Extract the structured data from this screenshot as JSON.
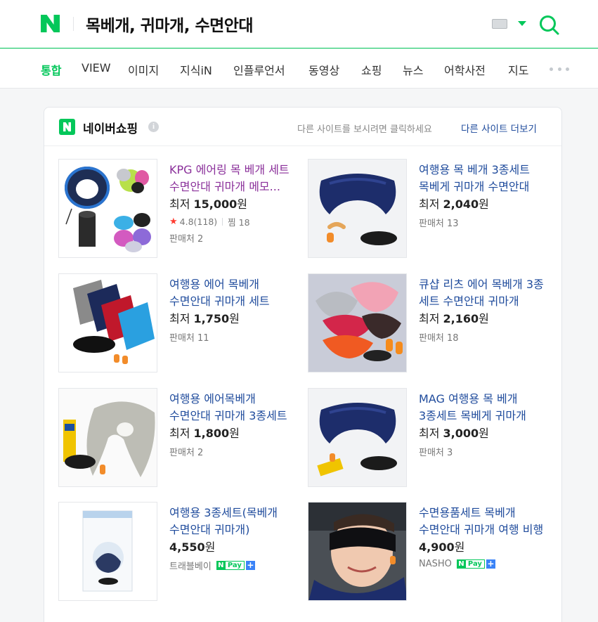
{
  "search": {
    "query": "목베개, 귀마개, 수면안대"
  },
  "tabs": [
    "통합",
    "VIEW",
    "이미지",
    "지식iN",
    "인플루언서",
    "동영상",
    "쇼핑",
    "뉴스",
    "어학사전",
    "지도"
  ],
  "shopping": {
    "title": "네이버쇼핑",
    "info_icon": "i",
    "hint": "다른 사이트를 보시려면 클릭하세요",
    "more_sites": "다른 사이트 더보기",
    "items": [
      {
        "title": "KPG 에어링 목 베개 세트 수면안대 귀마개 메모...",
        "price_prefix": "최저 ",
        "price": "15,000",
        "price_unit": "원",
        "rating": "4.8(118)",
        "wish": "찜 18",
        "seller": "판매처 2"
      },
      {
        "title": "여행용 목 베개 3종세트 목베게 귀마개 수면안대",
        "price_prefix": "최저 ",
        "price": "2,040",
        "price_unit": "원",
        "seller": "판매처 13"
      },
      {
        "title": "여행용 에어 목베개 수면안대 귀마개 세트",
        "price_prefix": "최저 ",
        "price": "1,750",
        "price_unit": "원",
        "seller": "판매처 11"
      },
      {
        "title": "큐샵 리츠 에어 목베개 3종 세트 수면안대 귀마개",
        "price_prefix": "최저 ",
        "price": "2,160",
        "price_unit": "원",
        "seller": "판매처 18"
      },
      {
        "title": "여행용 에어목베개 수면안대 귀마개 3종세트",
        "price_prefix": "최저 ",
        "price": "1,800",
        "price_unit": "원",
        "seller": "판매처 2"
      },
      {
        "title": "MAG 여행용 목 베개 3종세트 목베게 귀마개 수...",
        "price_prefix": "최저 ",
        "price": "3,000",
        "price_unit": "원",
        "seller": "판매처 3"
      },
      {
        "title": "여행용 3종세트(목베개 수면안대 귀마개)",
        "price_prefix": "",
        "price": "4,550",
        "price_unit": "원",
        "seller": "트래블베이",
        "npay": "Pay"
      },
      {
        "title": "수면용품세트 목베개 수면안대 귀마개 여행 비행",
        "price_prefix": "",
        "price": "4,900",
        "price_unit": "원",
        "seller": "NASHO",
        "npay": "Pay"
      }
    ]
  },
  "colors": {
    "brand": "#03c75a",
    "link": "#1f4b9c",
    "visited": "#8a2f9a"
  }
}
